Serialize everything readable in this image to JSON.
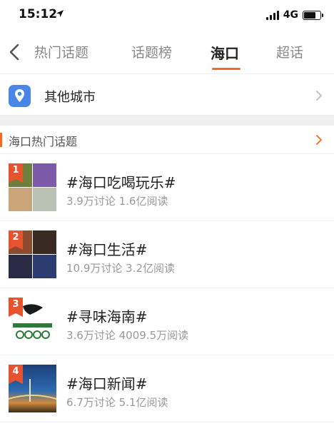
{
  "status_bar": {
    "time": "15:12",
    "network": "4G"
  },
  "tabs": [
    {
      "label": "热门话题"
    },
    {
      "label": "话题榜"
    },
    {
      "label": "海口"
    },
    {
      "label": "超话"
    }
  ],
  "city": {
    "label": "其他城市"
  },
  "section": {
    "title": "海口热门话题"
  },
  "topics": [
    {
      "rank": "1",
      "title": "#海口吃喝玩乐#",
      "meta": "3.9万讨论 1.6亿阅读"
    },
    {
      "rank": "2",
      "title": "#海口生活#",
      "meta": "10.9万讨论 3.2亿阅读"
    },
    {
      "rank": "3",
      "title": "#寻味海南#",
      "meta": "3.6万讨论 4009.5万阅读"
    },
    {
      "rank": "4",
      "title": "#海口新闻#",
      "meta": "6.7万讨论 5.1亿阅读"
    }
  ],
  "colors": {
    "accent": "#f36b21",
    "rank_badge": "#e8532f",
    "location_icon": "#4a86e8"
  },
  "icons": [
    "location-arrow-icon",
    "back-icon",
    "location-pin-icon",
    "chevron-right-icon"
  ]
}
